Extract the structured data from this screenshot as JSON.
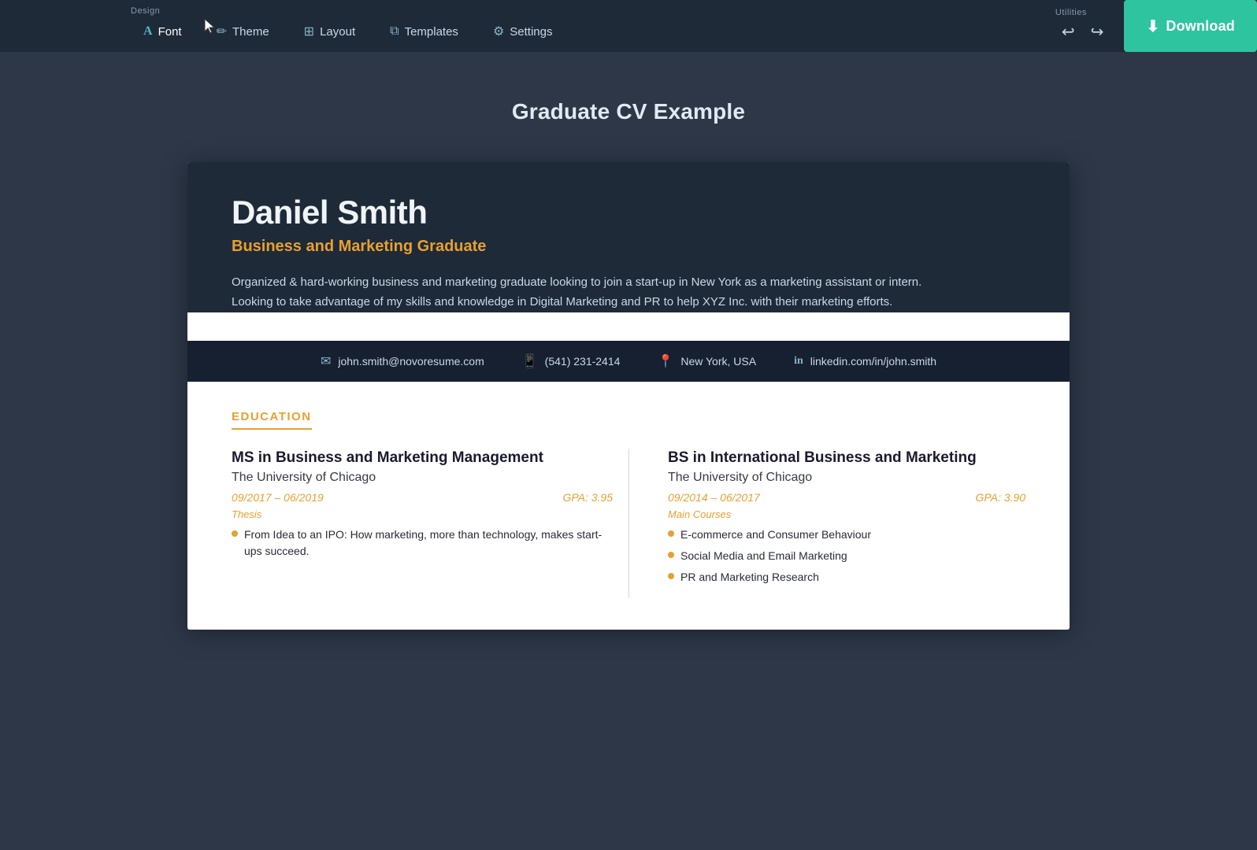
{
  "topbar": {
    "design_label": "Design",
    "utilities_label": "Utilities",
    "nav_items": [
      {
        "id": "font",
        "label": "Font",
        "icon": "A"
      },
      {
        "id": "theme",
        "label": "Theme",
        "icon": "✏"
      },
      {
        "id": "layout",
        "label": "Layout",
        "icon": "⊞"
      },
      {
        "id": "templates",
        "label": "Templates",
        "icon": "⧉"
      },
      {
        "id": "settings",
        "label": "Settings",
        "icon": "⚙"
      }
    ],
    "download_label": "Download"
  },
  "page": {
    "title": "Graduate CV Example"
  },
  "cv": {
    "name": "Daniel Smith",
    "title": "Business and Marketing Graduate",
    "summary": "Organized & hard-working business and marketing graduate looking to join a start-up in New York as a marketing assistant or intern. Looking to take advantage of my skills and knowledge in Digital Marketing and PR to help XYZ Inc. with their marketing efforts.",
    "contact": {
      "email": "john.smith@novoresume.com",
      "phone": "(541) 231-2414",
      "location": "New York, USA",
      "linkedin": "linkedin.com/in/john.smith"
    },
    "education": {
      "section_title": "EDUCATION",
      "items": [
        {
          "degree": "MS in Business and Marketing Management",
          "school": "The University of Chicago",
          "dates": "09/2017 – 06/2019",
          "gpa": "GPA: 3.95",
          "sub_label": "Thesis",
          "bullets": [
            "From Idea to an IPO: How marketing, more than technology, makes start-ups succeed."
          ]
        },
        {
          "degree": "BS in International Business and Marketing",
          "school": "The University of Chicago",
          "dates": "09/2014 – 06/2017",
          "gpa": "GPA: 3.90",
          "sub_label": "Main Courses",
          "bullets": [
            "E-commerce and Consumer Behaviour",
            "Social Media and Email Marketing",
            "PR and Marketing Research"
          ]
        }
      ]
    }
  }
}
